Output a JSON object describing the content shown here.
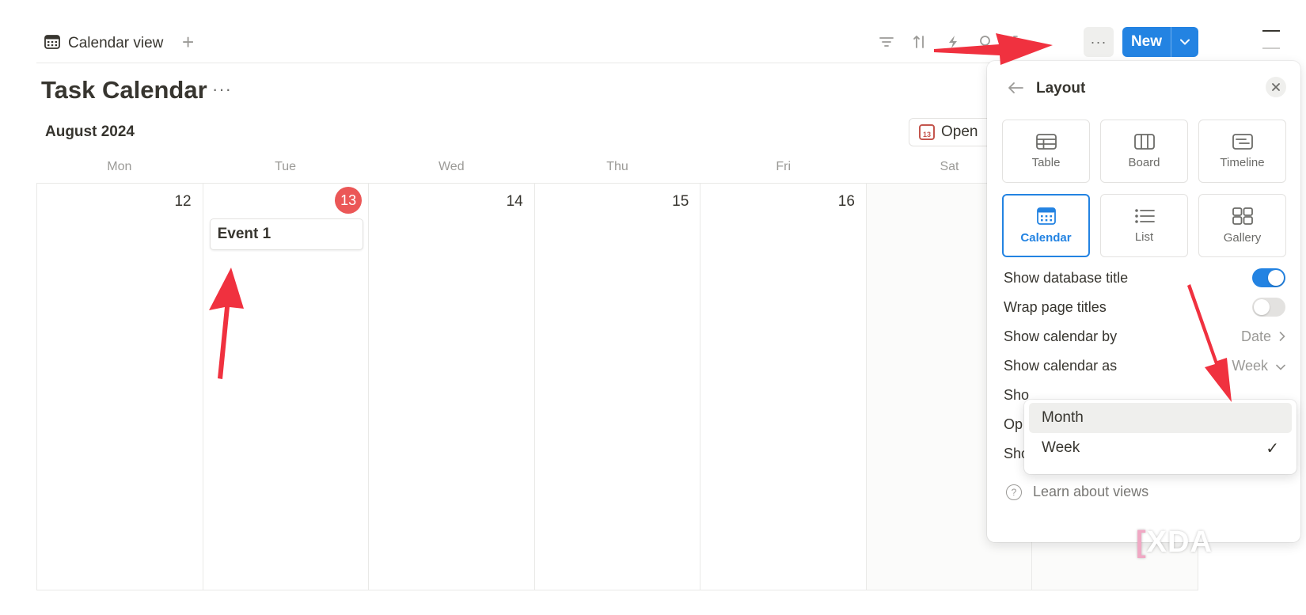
{
  "tabbar": {
    "view_tab_label": "Calendar view",
    "add_view": "+"
  },
  "toolbar": {
    "more_label": "···",
    "new_label": "New"
  },
  "page": {
    "title": "Task Calendar",
    "title_more": "···",
    "month_label": "August 2024",
    "open_label": "Open",
    "open_icon_day": "13"
  },
  "calendar": {
    "day_headers": [
      "Mon",
      "Tue",
      "Wed",
      "Thu",
      "Fri",
      "Sat"
    ],
    "dates": [
      "12",
      "13",
      "14",
      "15",
      "16"
    ],
    "today": "13",
    "event_title": "Event 1"
  },
  "panel": {
    "title": "Layout",
    "layouts": [
      "Table",
      "Board",
      "Timeline",
      "Calendar",
      "List",
      "Gallery"
    ],
    "active_layout": "Calendar",
    "settings": {
      "show_db_title": {
        "label": "Show database title",
        "on": true
      },
      "wrap_titles": {
        "label": "Wrap page titles",
        "on": false
      },
      "show_cal_by": {
        "label": "Show calendar by",
        "value": "Date"
      },
      "show_cal_as": {
        "label": "Show calendar as",
        "value": "Week"
      },
      "row5_partial": "Sho",
      "row6_partial": "Op",
      "show_page_icon": {
        "label": "Show page icon",
        "on": true
      }
    },
    "learn_label": "Learn about views"
  },
  "dropdown": {
    "options": [
      "Month",
      "Week"
    ],
    "selected": "Week",
    "hovered": "Month"
  },
  "watermark": "XDA",
  "colors": {
    "accent": "#2383e2",
    "today": "#eb5757",
    "annotation_arrow": "#f0313f"
  }
}
